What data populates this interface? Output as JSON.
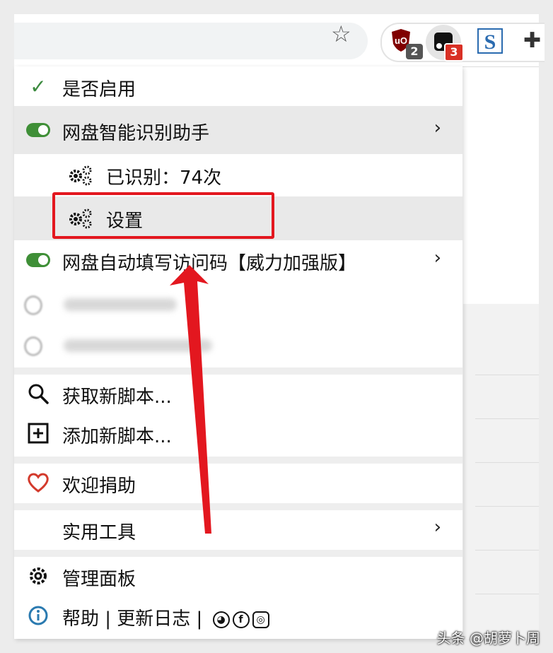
{
  "toolbar": {
    "bookmark_icon": "star-icon",
    "extensions": [
      {
        "name": "ublock-origin-icon",
        "badge": "2"
      },
      {
        "name": "tampermonkey-icon",
        "badge": "3"
      },
      {
        "name": "s-extension-icon",
        "label": "S"
      },
      {
        "name": "puzzle-icon"
      }
    ]
  },
  "menu": {
    "enabled_label": "是否启用",
    "script1": {
      "label": "网盘智能识别助手"
    },
    "recognized": "已识别：74次",
    "settings": "设置",
    "script2": {
      "label": "网盘自动填写访问码【威力加强版】"
    },
    "get_new": "获取新脚本...",
    "add_new": "添加新脚本...",
    "donate": "欢迎捐助",
    "utilities": "实用工具",
    "dashboard": "管理面板",
    "help": "帮助 | 更新日志 |"
  },
  "colors": {
    "toggle_on": "#3f8f37",
    "highlight": "#e3171f",
    "heart": "#d33a2c",
    "info": "#2a7ab0"
  },
  "watermark": "头条 @胡萝卜周"
}
